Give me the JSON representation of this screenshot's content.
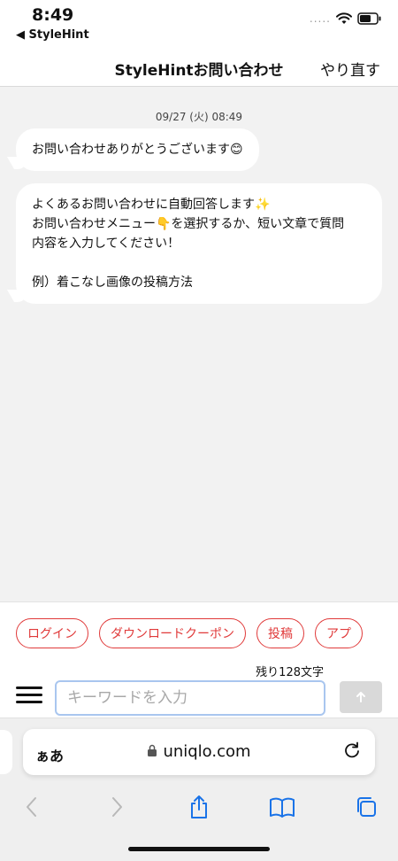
{
  "status": {
    "time": "8:49",
    "back_label": "◀ StyleHint",
    "signal_dots": "....."
  },
  "nav": {
    "title": "StyleHintお問い合わせ",
    "redo_label": "やり直す"
  },
  "chat": {
    "timestamp": "09/27 (火) 08:49",
    "messages": [
      {
        "lines": [
          "お問い合わせありがとうございます😊"
        ]
      },
      {
        "lines": [
          "よくあるお問い合わせに自動回答します✨",
          "お問い合わせメニュー👇を選択するか、短い文章で質問",
          "内容を入力してください！",
          "",
          "例）着こなし画像の投稿方法"
        ]
      }
    ]
  },
  "quick_replies": [
    "ログイン",
    "ダウンロードクーポン",
    "投稿",
    "アプ"
  ],
  "input": {
    "remaining": "残り128文字",
    "placeholder": "キーワードを入力",
    "value": ""
  },
  "browser": {
    "aa_label": "ぁあ",
    "url": "uniqlo.com"
  },
  "colors": {
    "accent_red": "#e03a3a",
    "input_border": "#a9c6ef",
    "ios_blue": "#1a73e8"
  },
  "icons": [
    "wifi-icon",
    "battery-icon",
    "menu-icon",
    "send-arrow-icon",
    "lock-icon",
    "reload-icon",
    "back-chevron-icon",
    "forward-chevron-icon",
    "share-icon",
    "bookmarks-icon",
    "tabs-icon"
  ]
}
